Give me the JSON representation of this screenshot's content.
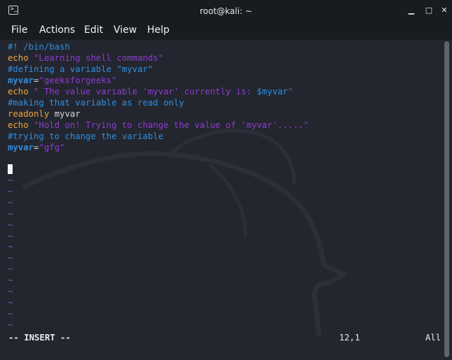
{
  "window": {
    "title": "root@kali: ~",
    "controls": {
      "minimize": "▁",
      "maximize": "□",
      "close": "✕"
    }
  },
  "menu": {
    "items": [
      "File",
      "Actions",
      "Edit",
      "View",
      "Help"
    ]
  },
  "editor": {
    "lines": [
      [
        {
          "text": "#! /bin/bash",
          "cls": "blue"
        }
      ],
      [
        {
          "text": "echo ",
          "cls": "orange"
        },
        {
          "text": "\"Learning shell commands\"",
          "cls": "purple"
        }
      ],
      [
        {
          "text": "#defining a variable \"myvar\"",
          "cls": "blue"
        }
      ],
      [
        {
          "text": "myvar",
          "cls": "blue bold"
        },
        {
          "text": "=",
          "cls": "white"
        },
        {
          "text": "\"geeksforgeeks\"",
          "cls": "purple"
        }
      ],
      [
        {
          "text": "echo ",
          "cls": "orange"
        },
        {
          "text": "\" The value variable 'myvar' currently is: ",
          "cls": "purple"
        },
        {
          "text": "$myvar",
          "cls": "blue"
        },
        {
          "text": "\"",
          "cls": "purple"
        }
      ],
      [
        {
          "text": "#making that variable as read only",
          "cls": "blue"
        }
      ],
      [
        {
          "text": "readonly",
          "cls": "orange"
        },
        {
          "text": " myvar",
          "cls": "white"
        }
      ],
      [
        {
          "text": "echo ",
          "cls": "orange"
        },
        {
          "text": "\"Hold on! Trying to change the value of 'myvar'.....\"",
          "cls": "purple"
        }
      ],
      [
        {
          "text": "#trying to change the variable",
          "cls": "blue"
        }
      ],
      [
        {
          "text": "myvar",
          "cls": "blue bold"
        },
        {
          "text": "=",
          "cls": "white"
        },
        {
          "text": "\"gfg\"",
          "cls": "purple"
        }
      ],
      [],
      [
        {
          "cursor": true
        }
      ]
    ],
    "tildes": [
      "~",
      "~",
      "~",
      "~",
      "~",
      "~",
      "~",
      "~",
      "~",
      "~",
      "~",
      "~",
      "~",
      "~"
    ],
    "status": {
      "mode": "-- INSERT --",
      "position": "12,1",
      "scroll": "All"
    }
  },
  "colors": {
    "background": "#23262e",
    "titlebar": "#181b20",
    "keyword": "#f0a541",
    "comment": "#2f8ee0",
    "string": "#8e3bd1",
    "tilde": "#3f74b7"
  }
}
